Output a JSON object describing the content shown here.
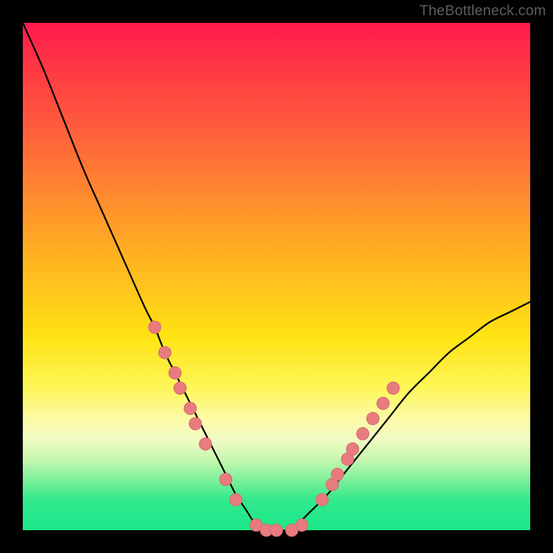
{
  "watermark": "TheBottleneck.com",
  "colors": {
    "bg": "#000000",
    "curve": "#000000",
    "marker_fill": "#e77b7e",
    "marker_stroke": "#d66a6e",
    "gradient_top": "#ff1a4d",
    "gradient_bottom": "#1ae78a"
  },
  "chart_data": {
    "type": "line",
    "title": "",
    "xlabel": "",
    "ylabel": "",
    "xlim": [
      0,
      100
    ],
    "ylim": [
      0,
      100
    ],
    "grid": false,
    "legend": false,
    "note": "Bottleneck-style V-curve. x is a normalized parameter (0–100); y is bottleneck percentage (0 = no bottleneck at the trough, 100 = maximum bottleneck).",
    "series": [
      {
        "name": "bottleneck-curve",
        "x": [
          0,
          4,
          8,
          12,
          16,
          20,
          24,
          26,
          28,
          30,
          32,
          34,
          36,
          38,
          40,
          42,
          44,
          46,
          48,
          50,
          52,
          54,
          56,
          60,
          64,
          68,
          72,
          76,
          80,
          84,
          88,
          92,
          96,
          100
        ],
        "y": [
          100,
          91,
          81,
          71,
          62,
          53,
          44,
          40,
          35,
          31,
          27,
          23,
          19,
          15,
          11,
          7,
          4,
          1,
          0,
          0,
          0,
          1,
          3,
          7,
          12,
          17,
          22,
          27,
          31,
          35,
          38,
          41,
          43,
          45
        ]
      }
    ],
    "markers": {
      "name": "sample-points",
      "note": "Highlighted sampled points along the curve (pink dots).",
      "points": [
        {
          "x": 26,
          "y": 40
        },
        {
          "x": 28,
          "y": 35
        },
        {
          "x": 30,
          "y": 31
        },
        {
          "x": 31,
          "y": 28
        },
        {
          "x": 33,
          "y": 24
        },
        {
          "x": 34,
          "y": 21
        },
        {
          "x": 36,
          "y": 17
        },
        {
          "x": 40,
          "y": 10
        },
        {
          "x": 42,
          "y": 6
        },
        {
          "x": 46,
          "y": 1
        },
        {
          "x": 48,
          "y": 0
        },
        {
          "x": 50,
          "y": 0
        },
        {
          "x": 53,
          "y": 0
        },
        {
          "x": 55,
          "y": 1
        },
        {
          "x": 59,
          "y": 6
        },
        {
          "x": 61,
          "y": 9
        },
        {
          "x": 62,
          "y": 11
        },
        {
          "x": 64,
          "y": 14
        },
        {
          "x": 65,
          "y": 16
        },
        {
          "x": 67,
          "y": 19
        },
        {
          "x": 69,
          "y": 22
        },
        {
          "x": 71,
          "y": 25
        },
        {
          "x": 73,
          "y": 28
        }
      ]
    }
  }
}
